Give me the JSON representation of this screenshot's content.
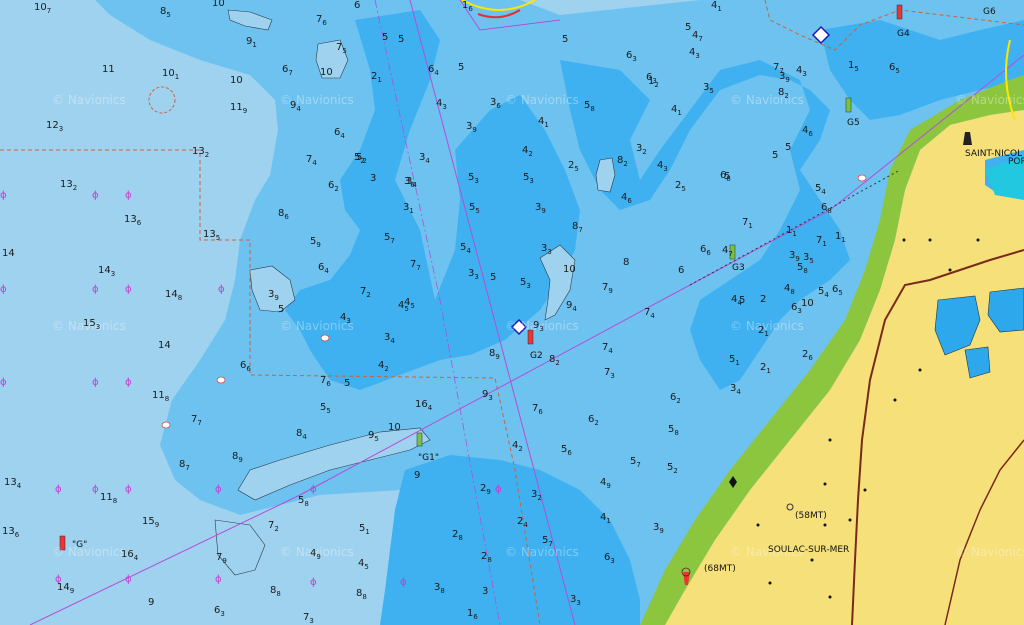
{
  "map": {
    "watermark": "© Navionics",
    "places": [
      {
        "id": "soulac",
        "label": "SOULAC-SUR-MER"
      },
      {
        "id": "saint-nicolas",
        "label": "SAINT-NICOL"
      },
      {
        "id": "port",
        "label": "POR"
      }
    ],
    "heights": [
      {
        "id": "h58",
        "label": "(58MT)"
      },
      {
        "id": "h68",
        "label": "(68MT)"
      }
    ],
    "buoys": [
      {
        "id": "g1",
        "label": "\"G1\""
      },
      {
        "id": "g2",
        "label": "G2"
      },
      {
        "id": "g3",
        "label": "G3"
      },
      {
        "id": "g4",
        "label": "G4"
      },
      {
        "id": "g5",
        "label": "G5"
      },
      {
        "id": "g6",
        "label": "G6"
      },
      {
        "id": "g",
        "label": "\"G\""
      }
    ],
    "colors": {
      "deep_water": "#9fd2ef",
      "mid_water": "#6ec2f0",
      "shallow_water": "#3fb1f0",
      "drying_green": "#8cc63f",
      "land": "#f5e07a",
      "route_magenta": "#b34fd6",
      "boundary_orange": "#c8643c"
    },
    "soundings": [
      {
        "main": "10",
        "sub": "7"
      },
      {
        "main": "8",
        "sub": "5"
      },
      {
        "main": "10",
        "sub": ""
      },
      {
        "main": "7",
        "sub": "6"
      },
      {
        "main": "6",
        "sub": ""
      },
      {
        "main": "9",
        "sub": "1"
      },
      {
        "main": "11",
        "sub": ""
      },
      {
        "main": "10",
        "sub": "1"
      },
      {
        "main": "10",
        "sub": ""
      },
      {
        "main": "6",
        "sub": "7"
      },
      {
        "main": "7",
        "sub": "5"
      },
      {
        "main": "10",
        "sub": ""
      },
      {
        "main": "11",
        "sub": "9"
      },
      {
        "main": "12",
        "sub": "3"
      },
      {
        "main": "9",
        "sub": "4"
      },
      {
        "main": "6",
        "sub": "4"
      },
      {
        "main": "13",
        "sub": "2"
      },
      {
        "main": "13",
        "sub": "2"
      },
      {
        "main": "7",
        "sub": "4"
      },
      {
        "main": "6",
        "sub": "2"
      },
      {
        "main": "13",
        "sub": "6"
      },
      {
        "main": "13",
        "sub": "5"
      },
      {
        "main": "8",
        "sub": "6"
      },
      {
        "main": "5",
        "sub": "9"
      },
      {
        "main": "14",
        "sub": ""
      },
      {
        "main": "14",
        "sub": "3"
      },
      {
        "main": "6",
        "sub": "4"
      },
      {
        "main": "14",
        "sub": "8"
      },
      {
        "main": "3",
        "sub": "9"
      },
      {
        "main": "5",
        "sub": ""
      },
      {
        "main": "15",
        "sub": "3"
      },
      {
        "main": "14",
        "sub": ""
      },
      {
        "main": "6",
        "sub": "6"
      },
      {
        "main": "11",
        "sub": "8"
      },
      {
        "main": "7",
        "sub": "7"
      },
      {
        "main": "8",
        "sub": "4"
      },
      {
        "main": "8",
        "sub": "7"
      },
      {
        "main": "8",
        "sub": "9"
      },
      {
        "main": "16",
        "sub": "4"
      },
      {
        "main": "13",
        "sub": "4"
      },
      {
        "main": "11",
        "sub": "8"
      },
      {
        "main": "15",
        "sub": "9"
      },
      {
        "main": "13",
        "sub": "6"
      },
      {
        "main": "16",
        "sub": "4"
      },
      {
        "main": "14",
        "sub": "9"
      },
      {
        "main": "9",
        "sub": ""
      },
      {
        "main": "7",
        "sub": "9"
      },
      {
        "main": "8",
        "sub": "8"
      },
      {
        "main": "6",
        "sub": "3"
      },
      {
        "main": "7",
        "sub": "3"
      },
      {
        "main": "7",
        "sub": "2"
      },
      {
        "main": "5",
        "sub": "8"
      },
      {
        "main": "5",
        "sub": "1"
      },
      {
        "main": "4",
        "sub": "5"
      },
      {
        "main": "5",
        "sub": "2"
      },
      {
        "main": "4",
        "sub": "9"
      },
      {
        "main": "7",
        "sub": "6"
      },
      {
        "main": "5",
        "sub": "5"
      },
      {
        "main": "9",
        "sub": "5"
      },
      {
        "main": "10",
        "sub": ""
      },
      {
        "main": "4",
        "sub": "5"
      },
      {
        "main": "8",
        "sub": "8"
      },
      {
        "main": "9",
        "sub": ""
      },
      {
        "main": "5",
        "sub": ""
      },
      {
        "main": "4",
        "sub": "2"
      },
      {
        "main": "3",
        "sub": "4"
      },
      {
        "main": "4",
        "sub": "3"
      },
      {
        "main": "7",
        "sub": "2"
      },
      {
        "main": "4",
        "sub": "5"
      },
      {
        "main": "7",
        "sub": "7"
      },
      {
        "main": "5",
        "sub": "7"
      },
      {
        "main": "3",
        "sub": "1"
      },
      {
        "main": "3",
        "sub": "4"
      },
      {
        "main": "3",
        "sub": ""
      },
      {
        "main": "5",
        "sub": "2"
      },
      {
        "main": "3",
        "sub": "4"
      },
      {
        "main": "3",
        "sub": "6"
      },
      {
        "main": "2",
        "sub": "1"
      },
      {
        "main": "5",
        "sub": ""
      },
      {
        "main": "5",
        "sub": ""
      },
      {
        "main": "1",
        "sub": "6"
      },
      {
        "main": "6",
        "sub": "4"
      },
      {
        "main": "5",
        "sub": ""
      },
      {
        "main": "4",
        "sub": "3"
      },
      {
        "main": "3",
        "sub": "6"
      },
      {
        "main": "3",
        "sub": "9"
      },
      {
        "main": "4",
        "sub": "1"
      },
      {
        "main": "4",
        "sub": "2"
      },
      {
        "main": "5",
        "sub": "3"
      },
      {
        "main": "5",
        "sub": "3"
      },
      {
        "main": "5",
        "sub": "5"
      },
      {
        "main": "5",
        "sub": "4"
      },
      {
        "main": "3",
        "sub": "3"
      },
      {
        "main": "5",
        "sub": ""
      },
      {
        "main": "5",
        "sub": "3"
      },
      {
        "main": "3",
        "sub": "9"
      },
      {
        "main": "3",
        "sub": "3"
      },
      {
        "main": "5",
        "sub": ""
      },
      {
        "main": "5",
        "sub": "8"
      },
      {
        "main": "2",
        "sub": "5"
      },
      {
        "main": "8",
        "sub": "2"
      },
      {
        "main": "8",
        "sub": "7"
      },
      {
        "main": "10",
        "sub": ""
      },
      {
        "main": "9",
        "sub": "4"
      },
      {
        "main": "9",
        "sub": "3"
      },
      {
        "main": "7",
        "sub": "9"
      },
      {
        "main": "8",
        "sub": ""
      },
      {
        "main": "8",
        "sub": "9"
      },
      {
        "main": "8",
        "sub": "2"
      },
      {
        "main": "7",
        "sub": "4"
      },
      {
        "main": "7",
        "sub": "4"
      },
      {
        "main": "9",
        "sub": "3"
      },
      {
        "main": "7",
        "sub": "6"
      },
      {
        "main": "5",
        "sub": "6"
      },
      {
        "main": "4",
        "sub": "2"
      },
      {
        "main": "2",
        "sub": "9"
      },
      {
        "main": "3",
        "sub": "2"
      },
      {
        "main": "2",
        "sub": "4"
      },
      {
        "main": "5",
        "sub": "7"
      },
      {
        "main": "2",
        "sub": "8"
      },
      {
        "main": "2",
        "sub": "8"
      },
      {
        "main": "3",
        "sub": ""
      },
      {
        "main": "3",
        "sub": "8"
      },
      {
        "main": "3",
        "sub": "3"
      },
      {
        "main": "1",
        "sub": "6"
      },
      {
        "main": "6",
        "sub": "2"
      },
      {
        "main": "4",
        "sub": "9"
      },
      {
        "main": "4",
        "sub": "1"
      },
      {
        "main": "3",
        "sub": "9"
      },
      {
        "main": "6",
        "sub": "3"
      },
      {
        "main": "5",
        "sub": "7"
      },
      {
        "main": "5",
        "sub": "2"
      },
      {
        "main": "5",
        "sub": "8"
      },
      {
        "main": "6",
        "sub": "2"
      },
      {
        "main": "7",
        "sub": "3"
      },
      {
        "main": "6",
        "sub": "3"
      },
      {
        "main": "6",
        "sub": ""
      },
      {
        "main": "6",
        "sub": "6"
      },
      {
        "main": "7",
        "sub": "1"
      },
      {
        "main": "6",
        "sub": "8"
      },
      {
        "main": "5",
        "sub": ""
      },
      {
        "main": "4",
        "sub": "3"
      },
      {
        "main": "3",
        "sub": "5"
      },
      {
        "main": "4",
        "sub": "3"
      },
      {
        "main": "4",
        "sub": "1"
      },
      {
        "main": "4",
        "sub": "6"
      },
      {
        "main": "4",
        "sub": "4"
      },
      {
        "main": "5",
        "sub": "1"
      },
      {
        "main": "2",
        "sub": "5"
      },
      {
        "main": "3",
        "sub": "2"
      },
      {
        "main": "1",
        "sub": "2"
      },
      {
        "main": "4",
        "sub": "7"
      },
      {
        "main": "4",
        "sub": "1"
      },
      {
        "main": "5",
        "sub": ""
      },
      {
        "main": "5",
        "sub": ""
      },
      {
        "main": "2",
        "sub": "1"
      },
      {
        "main": "5",
        "sub": ""
      },
      {
        "main": "3",
        "sub": "4"
      },
      {
        "main": "6",
        "sub": "3"
      },
      {
        "main": "5",
        "sub": "4"
      },
      {
        "main": "2",
        "sub": "6"
      },
      {
        "main": "3",
        "sub": "5"
      },
      {
        "main": "6",
        "sub": "8"
      },
      {
        "main": "8",
        "sub": "2"
      },
      {
        "main": "4",
        "sub": "6"
      },
      {
        "main": "3",
        "sub": "9"
      },
      {
        "main": "5",
        "sub": "4"
      },
      {
        "main": "5",
        "sub": ""
      },
      {
        "main": "6",
        "sub": "3"
      },
      {
        "main": "4",
        "sub": "3"
      },
      {
        "main": "4",
        "sub": "7"
      },
      {
        "main": "3",
        "sub": "9"
      },
      {
        "main": "7",
        "sub": "7"
      },
      {
        "main": "10",
        "sub": ""
      },
      {
        "main": "4",
        "sub": "8"
      },
      {
        "main": "5",
        "sub": "8"
      },
      {
        "main": "6",
        "sub": "5"
      },
      {
        "main": "7",
        "sub": "1"
      },
      {
        "main": "1",
        "sub": "1"
      },
      {
        "main": "1",
        "sub": "1"
      },
      {
        "main": "2",
        "sub": "1"
      },
      {
        "main": "2",
        "sub": ""
      },
      {
        "main": "1",
        "sub": "5"
      },
      {
        "main": "6",
        "sub": "5"
      }
    ]
  }
}
